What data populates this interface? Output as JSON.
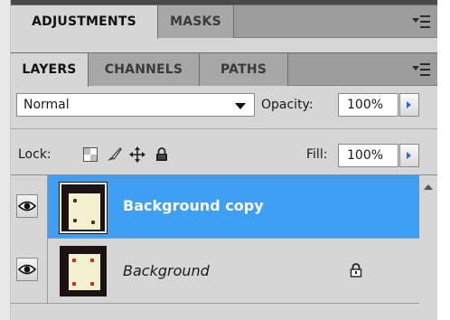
{
  "top_tabs": [
    {
      "label": "ADJUSTMENTS",
      "active": true
    },
    {
      "label": "MASKS",
      "active": false
    }
  ],
  "layer_tabs": [
    {
      "label": "LAYERS",
      "active": true
    },
    {
      "label": "CHANNELS",
      "active": false
    },
    {
      "label": "PATHS",
      "active": false
    }
  ],
  "blend_mode": "Normal",
  "opacity": {
    "label": "Opacity:",
    "value": "100%"
  },
  "lock": {
    "label": "Lock:",
    "icons": [
      "transparency-lock-icon",
      "brush-lock-icon",
      "move-lock-icon",
      "padlock-icon"
    ]
  },
  "fill": {
    "label": "Fill:",
    "value": "100%"
  },
  "layers": [
    {
      "name": "Background copy",
      "selected": true,
      "italic": false,
      "locked": false
    },
    {
      "name": "Background",
      "selected": false,
      "italic": true,
      "locked": true
    }
  ],
  "colors": {
    "selection": "#3f9ff5",
    "panel": "#d6d6d6",
    "tab_bar": "#9c9c9c",
    "accent_arrow": "#2a69c8"
  }
}
